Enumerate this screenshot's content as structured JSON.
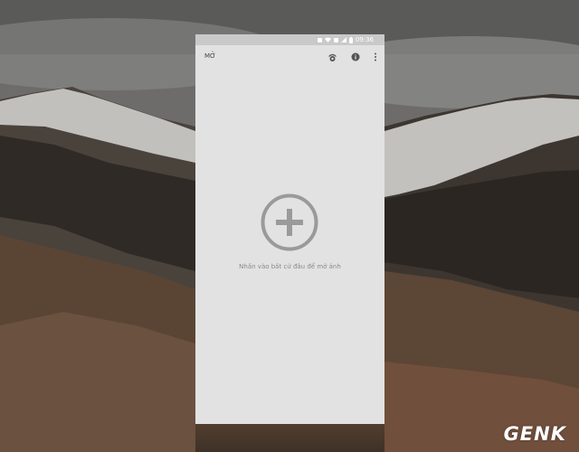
{
  "status_bar": {
    "time": "09:36",
    "icons": [
      "image-notification-icon",
      "wifi-icon",
      "no-sim-icon",
      "signal-icon",
      "battery-icon"
    ]
  },
  "app_bar": {
    "title": "MỞ",
    "icons": [
      "looks-icon",
      "info-icon",
      "more-vert-icon"
    ]
  },
  "main": {
    "add_icon": "plus-circle-icon",
    "hint": "Nhấn vào bất cứ đâu để mở ảnh"
  },
  "watermark": {
    "text": "GENK"
  },
  "colors": {
    "phone_background": "#e2e2e2",
    "status_bar": "#c9c9c9",
    "plus_icon": "#9a9a9a",
    "hint_text": "#8a8a8a"
  }
}
